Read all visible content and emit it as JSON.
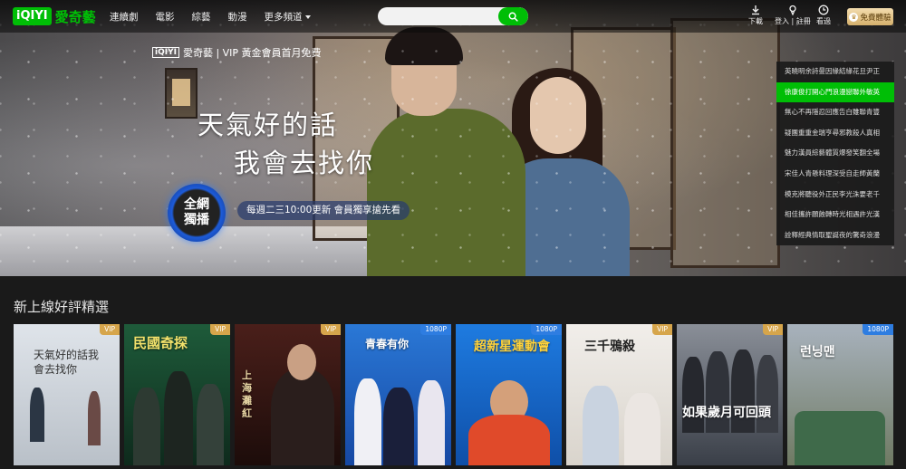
{
  "header": {
    "logo_mark": "iQIYI",
    "logo_text": "愛奇藝",
    "nav": [
      "連續劇",
      "電影",
      "綜藝",
      "動漫",
      "更多頻道"
    ],
    "search_placeholder": "",
    "tools": {
      "download": "下載",
      "login": "登入 | 註冊",
      "history": "看過"
    },
    "vip_button": "免費體驗"
  },
  "hero": {
    "brand_mark": "iQIYI",
    "brand_text": "愛奇藝 | VIP 黃金會員首月免費",
    "title_line1": "天氣好的話",
    "title_line2": "我會去找你",
    "badge_line1": "全網",
    "badge_line2": "獨播",
    "schedule": "每週二三10:00更新  會員獨享搶先看",
    "list": [
      "英曉明余詩曼因緣結緣花旦尹正",
      "徐康俊打開心門浪漫戀聯外敏英",
      "無心不再隱忍回應告白雖聯青豐",
      "疑團重重金瑞亨尋邪教殺人真相",
      "魅力漢員綜藝體質爆發笑翻全場",
      "宋佳人青懸料理深受自走師黃蘭",
      "模克將聽役外正民李光洙要老千",
      "相佳攜許願蝕轉時光相遇許光漢",
      "詮釋經典情取聖誕夜的驚奇浪漫"
    ],
    "active_index": 1
  },
  "section": {
    "title": "新上線好評精選",
    "cards": [
      {
        "tag": "VIP",
        "title": "天氣好的話我會去找你"
      },
      {
        "tag": "VIP",
        "title": "民國奇探"
      },
      {
        "tag": "VIP",
        "title": "上海灘紅"
      },
      {
        "tag": "1080P",
        "title": "青春有你"
      },
      {
        "tag": "1080P",
        "title": "超新星運動會"
      },
      {
        "tag": "VIP",
        "title": "三千鴉殺"
      },
      {
        "tag": "VIP",
        "title": "如果歲月可回頭"
      },
      {
        "tag": "1080P",
        "title": "런닝맨"
      }
    ]
  },
  "colors": {
    "accent": "#00be06",
    "vip_tag": "#d6a54b",
    "hd_tag": "#2e7de1",
    "background": "#1a1a1a"
  }
}
